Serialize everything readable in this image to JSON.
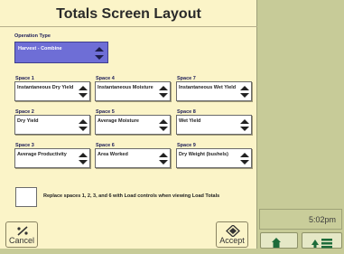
{
  "title": "Totals Screen Layout",
  "operation": {
    "label": "Operation Type",
    "value": "Harvest - Combine"
  },
  "spaces": [
    {
      "label": "Space 1",
      "value": "Instantaneous Dry Yield"
    },
    {
      "label": "Space 4",
      "value": "Instantaneous Moisture"
    },
    {
      "label": "Space 7",
      "value": "Instantaneous Wet Yield"
    },
    {
      "label": "Space 2",
      "value": "Dry Yield"
    },
    {
      "label": "Space 5",
      "value": "Average Moisture"
    },
    {
      "label": "Space 8",
      "value": "Wet Yield"
    },
    {
      "label": "Space 3",
      "value": "Average Productivity"
    },
    {
      "label": "Space 6",
      "value": "Area Worked"
    },
    {
      "label": "Space 9",
      "value": "Dry Weight (bushels)"
    }
  ],
  "checkbox_label": "Replace spaces 1, 2, 3, and 6 with Load controls when viewing Load Totals",
  "buttons": {
    "cancel": "Cancel",
    "accept": "Accept"
  },
  "clock": "5:02pm",
  "colors": {
    "background": "#fbf4c8",
    "side_panel": "#c7cb98",
    "operation_select": "#6e6ed6"
  },
  "icons": {
    "cancel": "cancel-icon",
    "accept": "accept-icon",
    "home": "home-icon",
    "menu": "menu-icon"
  }
}
